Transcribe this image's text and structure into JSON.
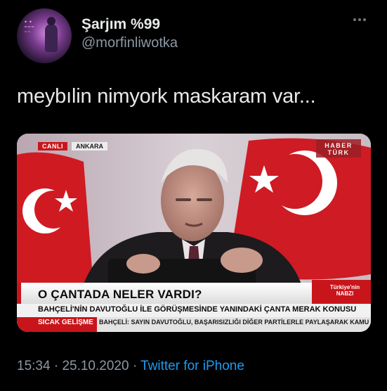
{
  "tweet": {
    "display_name": "Şarjım %99",
    "handle": "@morfinliwotka",
    "text": "meybılin nimyork maskaram var...",
    "time": "15:34",
    "separator1": "·",
    "date": "25.10.2020",
    "separator2": "·",
    "source": "Twitter for iPhone",
    "more_icon": "ellipsis-icon"
  },
  "media": {
    "live_tag": "CANLI",
    "city_tag": "ANKARA",
    "channel_logo": "HABER TÜRK",
    "headline": "O ÇANTADA NELER VARDI?",
    "subheadline": "BAHÇELİ'NİN DAVUTOĞLU İLE GÖRÜŞMESİNDE YANINDAKİ ÇANTA MERAK KONUSU",
    "corner_badge": "Türkiye'nin NABZI",
    "hot_label": "SICAK GELİŞME",
    "crawl_text": "BAHÇELİ: SAYIN DAVUTOĞLU, BAŞARISIZLIĞI DİĞER PARTİLERLE PAYLAŞARAK KAMU"
  },
  "colors": {
    "background": "#000000",
    "text": "#e7e9ea",
    "muted": "#8b98a5",
    "link": "#1d9bf0",
    "news_red": "#c8151b"
  }
}
